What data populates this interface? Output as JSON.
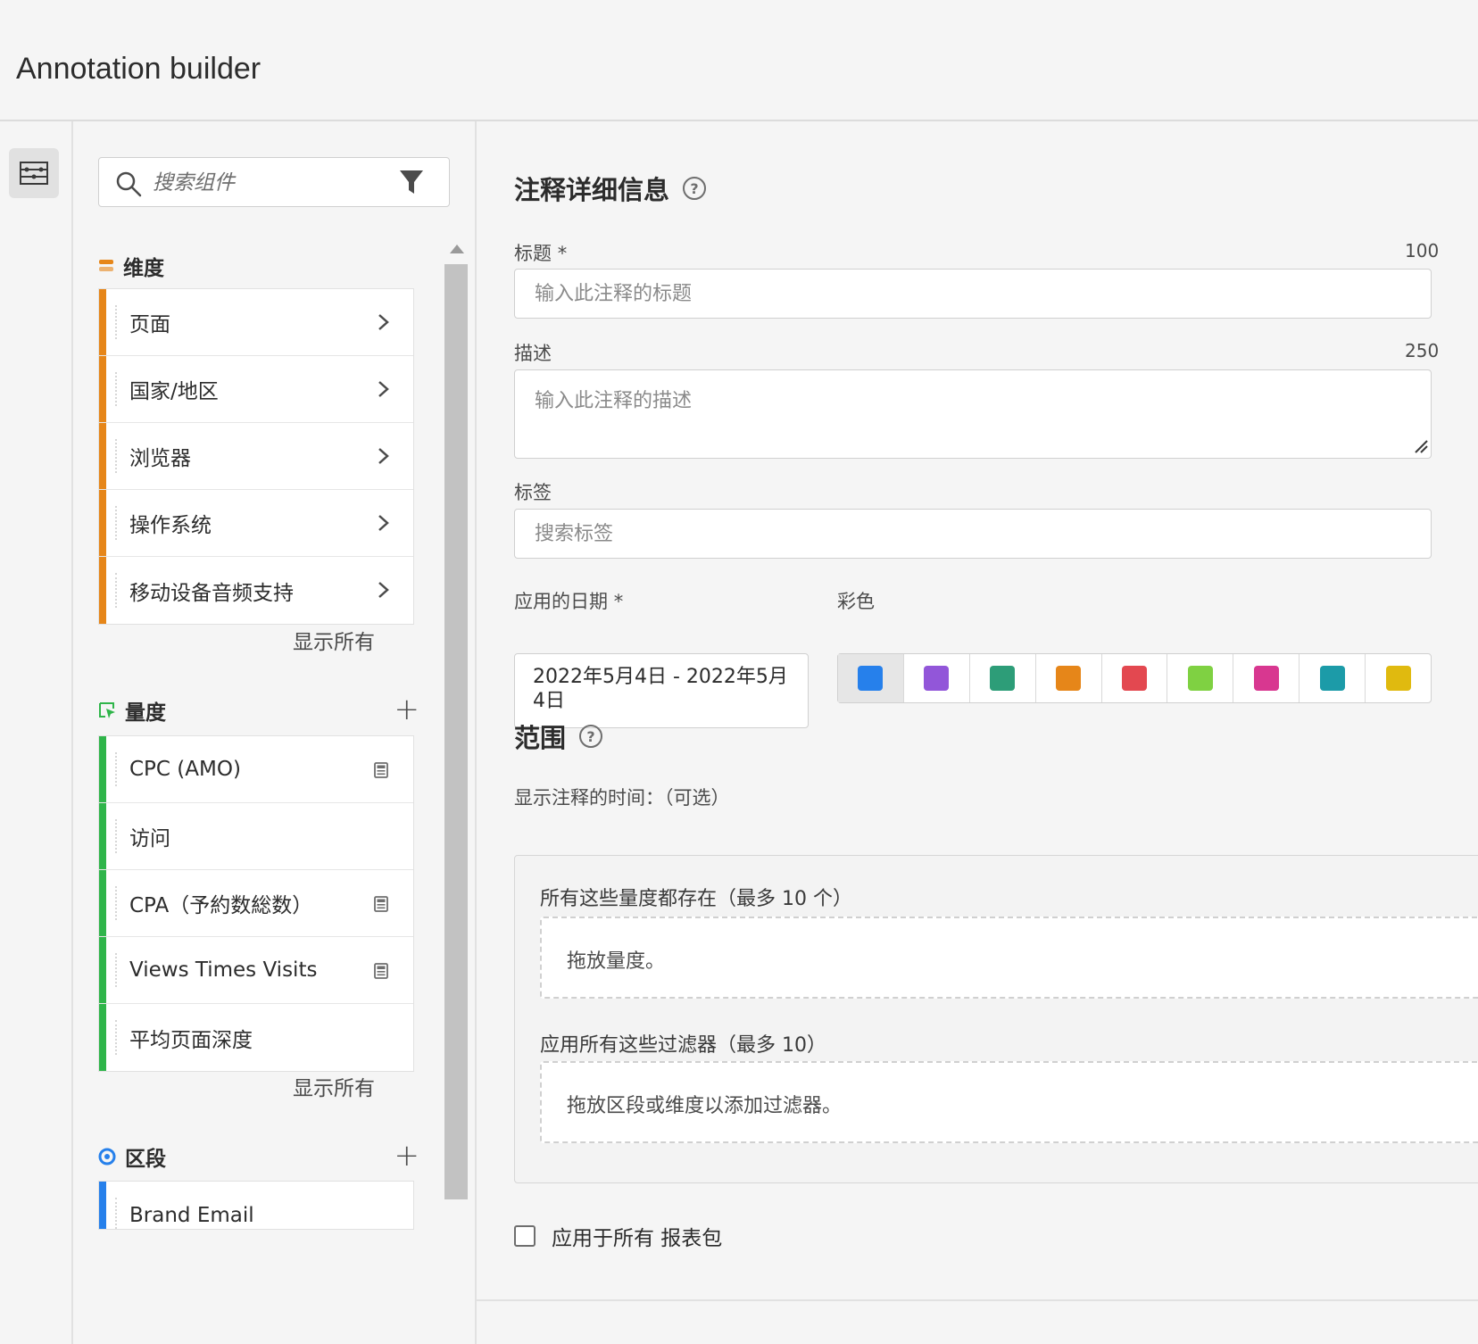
{
  "app": {
    "title": "Annotation builder"
  },
  "search": {
    "placeholder": "搜索组件"
  },
  "dimensions": {
    "title": "维度",
    "items": [
      "页面",
      "国家/地区",
      "浏览器",
      "操作系统",
      "移动设备音频支持"
    ],
    "show_all": "显示所有",
    "color": "#e68619"
  },
  "metrics": {
    "title": "量度",
    "items": [
      "CPC (AMO)",
      "访问",
      "CPA（予約数総数）",
      "Views Times Visits",
      "平均页面深度"
    ],
    "calculated": [
      true,
      false,
      true,
      true,
      false
    ],
    "show_all": "显示所有",
    "color": "#2fb54a"
  },
  "segments": {
    "title": "区段",
    "items": [
      "Brand Email"
    ],
    "color": "#2680eb"
  },
  "details": {
    "heading": "注释详细信息",
    "title_label": "标题",
    "required_mark": "*",
    "title_max": "100",
    "title_placeholder": "输入此注释的标题",
    "desc_label": "描述",
    "desc_max": "250",
    "desc_placeholder": "输入此注释的描述",
    "tags_label": "标签",
    "tags_placeholder": "搜索标签",
    "date_label": "应用的日期",
    "date_value": "2022年5月4日 - 2022年5月4日",
    "color_label": "彩色",
    "colors": [
      "#2680eb",
      "#9256d9",
      "#2d9d78",
      "#e68619",
      "#e34850",
      "#7fd142",
      "#d83790",
      "#1c9ba8",
      "#e0ba0f"
    ],
    "selected_color": 0
  },
  "scope": {
    "heading": "范围",
    "when_label": "显示注释的时间：（可选）",
    "metrics_label": "所有这些量度都存在（最多 10 个）",
    "metrics_drop": "拖放量度。",
    "filters_label": "应用所有这些过滤器（最多 10）",
    "filters_drop": "拖放区段或维度以添加过滤器。",
    "apply_all_label": "应用于所有 报表包"
  }
}
